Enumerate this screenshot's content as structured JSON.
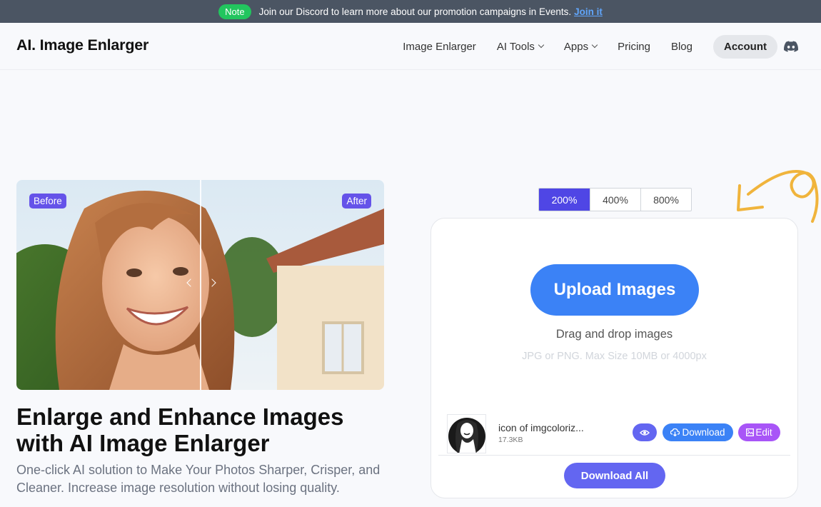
{
  "announcement": {
    "badge": "Note",
    "text": "Join our Discord to learn more about our promotion campaigns in Events.",
    "link": "Join it"
  },
  "header": {
    "logo": "AI. Image Enlarger",
    "nav": [
      {
        "label": "Image Enlarger"
      },
      {
        "label": "AI Tools"
      },
      {
        "label": "Apps"
      },
      {
        "label": "Pricing"
      },
      {
        "label": "Blog"
      }
    ],
    "account": "Account",
    "discord_icon": "discord-icon"
  },
  "compare": {
    "before_label": "Before",
    "after_label": "After"
  },
  "hero": {
    "title": "Enlarge and Enhance Images with AI Image Enlarger",
    "subtitle": "One-click AI solution to Make Your Photos Sharper, Crisper, and Cleaner. Increase image resolution without losing quality."
  },
  "scales": {
    "options": [
      "200%",
      "400%",
      "800%"
    ],
    "selected": "200%"
  },
  "upload": {
    "button": "Upload Images",
    "drag_text": "Drag and drop images",
    "limits": "JPG or PNG. Max Size 10MB or 4000px"
  },
  "file": {
    "name": "icon of imgcoloriz...",
    "size": "17.3KB",
    "download": "Download",
    "edit": "Edit"
  },
  "download_all": "Download All",
  "colors": {
    "accent": "#4f46e5",
    "upload_blue": "#3b82f6",
    "edit_purple": "#a855f7",
    "note_green": "#22c55e",
    "curly_arrow": "#f0b43c"
  }
}
